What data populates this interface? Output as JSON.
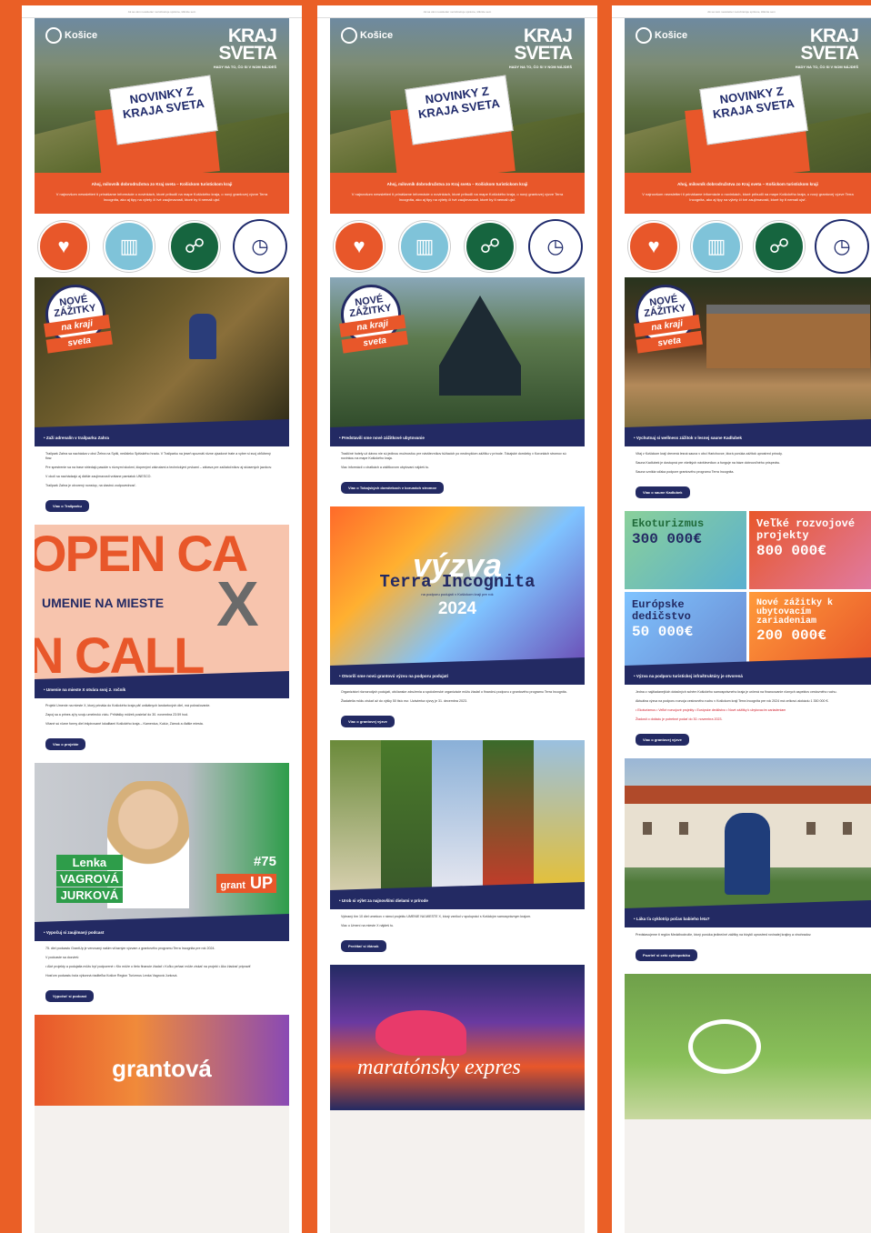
{
  "header": {
    "logo": "Košice",
    "kraj_line1": "KRAJ",
    "kraj_line2": "SVETA",
    "kraj_sub": "HADY NA TO, ČO SI V NOM NÁJDEŠ",
    "card": "NOVINKY Z KRAJA SVETA",
    "banner_title": "Ahoj, milovník dobrodružstva zo Kraj sveta – Košickom turistickom kraji",
    "banner_text": "V najnovšom newsletteri ti prinášame informácie o novinkách, ktoré pribudli na mape Košického kraja, o nový grantovej výzve Terra Incognita, ako aj tipy na výlety či tvé zaujímavosti, ktoré by ti nemali ujsť."
  },
  "icons": [
    "heart-mountain-icon",
    "stone-pillar-icon",
    "climber-icon",
    "clock-icon"
  ],
  "badge": {
    "line1": "NOVÉ",
    "line2": "ZÁŽITKY",
    "line3": "na kraji",
    "line4": "sveta"
  },
  "col1": {
    "a1": {
      "caption": "• Zaži adrenalín v trailparku Zahra",
      "p1": "Trailpark Zahra sa nachádza v obci Žehra na Spiši, neďaleko Spišského hradu. V Trailparku na jeseň spoznáš rôzne zjazdové trate a vyber si svoj obľúbený flow.",
      "p2": "Pre spestrenie sa na trase striedajú pasáže s rôznymi skokmi, klopenými zákrutami a technickými prvkami – zábava pre začiatočníkov aj skúsených jazdcov.",
      "p3": "V okolí sa nachádzajú aj ďalšie zaujímavosti vrátane pamiatok UNESCO.",
      "p4": "Trailpark Zahra je otvorený nonstop, na vlastnú zodpovednosť.",
      "btn": "Viac o Trailparku"
    },
    "opencall": {
      "big1": "OPEN CA",
      "mid": "UMENIE NA MIESTE",
      "x": "X",
      "big2": "N CALL"
    },
    "a2": {
      "caption": "• Umenie na mieste X otvára svoj 2. ročník",
      "p1": "Projekt Umenie na mieste X, ktorý prináša do Košického kraja päť unikátnych landartových diel, má pokračovanie.",
      "p2": "Zapoj sa a prines aj ty svoju umeleckú víziu. Prihlášky môžeš posielať do 30. novembra 23:59 hod.",
      "p2red": "do 30. novembra 23:59 hod.",
      "p3": "Vítané sú rôzne formy diel inšpirované lokalitami Košického kraja – Kamenica, Kukúr, Zámok a ďalšie miesta.",
      "btn": "Viac o projekte"
    },
    "lenka": {
      "n1": "Lenka",
      "n2": "VAGROVÁ",
      "n3": "JURKOVÁ",
      "no": "#75",
      "grant": "grant",
      "up": "UP"
    },
    "a3": {
      "caption": "• Vypočuj si zaujímavý podcast",
      "p1": "75. diel podcastu GrantUp je venovaný našim víťazným výzvam z grantového programu Terra Incognita pre rok 2024.",
      "p2": "V podcaste sa dozvieš:",
      "p3": "• Aké projekty a podujatia môžu byť podporené • Kto môže o tieto financie žiadať • Koľko peňazí môže získať na projekt • Ako žiadosť pripraviť",
      "p4": "Hosťom podcastu bola výkonná riaditeľka Košice Region Turizmus Lenka Vagrová Jurková.",
      "btn": "Vypočuť si podcast"
    },
    "grant": "grantová"
  },
  "col2": {
    "a1": {
      "caption": "• Predstavili sme nové zážitkové ubytovanie",
      "p1": "Tradičné hotely už dávno nie sú jedinou možnosťou pre návštevníkov túžiacich po neobvyklom zážitku v prírode. Tokajské domčeky v Koroniách stromov sú novinkou na mape Košického kraja.",
      "p2": "Viac informácií o chatkách a zážitkovom ubytovaní nájdeš tu.",
      "btn": "Viac o Tokajských domčekoch v korunách stromov"
    },
    "vyzva": {
      "v1": "výzva",
      "v2": "Terra Incognita",
      "v3": "na podporu podujatí v Košickom kraji pre rok",
      "v4": "2024"
    },
    "a2": {
      "caption": "• Otvorili sme novú grantovú výzvu na podporu podujatí",
      "p1": "Organizátori rôznorodých podujatí, občianske združenia a spoločenské organizácie môžu žiadať o finančnú podporu z grantového programu Terra Incognita.",
      "p2": "Žiadatelia môžu získať až do výšky 50 tisíc eur. Uzávierka výzvy je 31. decembra 2023.",
      "btn": "Viac o grantovej výzve"
    },
    "a3": {
      "caption": "• Urob si výlet za najnovšími dielami v prírode",
      "p1": "Vybraný tím 10 diel umelcov v rámci projektu UMENIE NA MIESTE X, ktorý vznikol v spolupráci s Košickým samosprávnym krajom.",
      "p2": "Viac o Umení na mieste X nájdeš tu.",
      "btn": "Prečítať si článok"
    },
    "marathon": "maratónsky expres"
  },
  "col3": {
    "a1": {
      "caption": "• Vychutnaj si wellness zážitok v lesnej saune Kadlubek",
      "p1": "Vitaj v Košickom kraji drevená lesná sauna v obci Harichovce, ktorá ponúka zážitok uprostred prírody.",
      "p2": "Sauna Kadlubek je dostupná pre všetkých návštevníkov a funguje na báze dobrovoľného príspevku.",
      "p3": "Sauna vznikla vďaka podpore grantového programu Terra Incognita.",
      "btn": "Viac o saune Kadlubek"
    },
    "grid": {
      "t1": "Ekoturizmus",
      "a1": "300 000€",
      "t2": "Veľké rozvojové projekty",
      "a2": "800 000€",
      "t3": "Európske dedičstvo",
      "a3": "50 000€",
      "t4": "Nové zážitky k ubytovacím zariadeniam",
      "a4": "200 000€"
    },
    "a2": {
      "caption": "• Výzva na podporu turistickej infraštruktúry je otvorená",
      "p1": "Jedna z najžiadanejších dotačných schém Košického samosprávneho kraja je určená na financovanie rôznych aspektov cestovného ruchu.",
      "p2": "Aktuálna výzva na podporu rozvoja cestovného ruchu v Košickom kraji Terra Incognita pre rok 2024 má celkovú alokáciu 1 350 000 €.",
      "p3": "• Ekoturizmus • Veľké rozvojové projekty • Európske dedičstvo • Nové zážitky k ubytovacím zariadeniam",
      "p4": "Žiadosti o dotáciu je potrebné podať do 30. novembra 2023.",
      "btn": "Viac o grantovej výzve"
    },
    "a3": {
      "caption": "• Láka ťa cyklotrip počas babieho leta?",
      "p1": "Predstavujeme ti región Medzibodrožie, ktorý ponúka jedinečné zážitky na bicykli uprostred rovinatej krajiny a vinohradov.",
      "btn": "Pozrieť si celú cyklopotúku"
    }
  },
  "topbar": "Ak sa vám newsletter nezobrazuje správne, kliknite sem"
}
